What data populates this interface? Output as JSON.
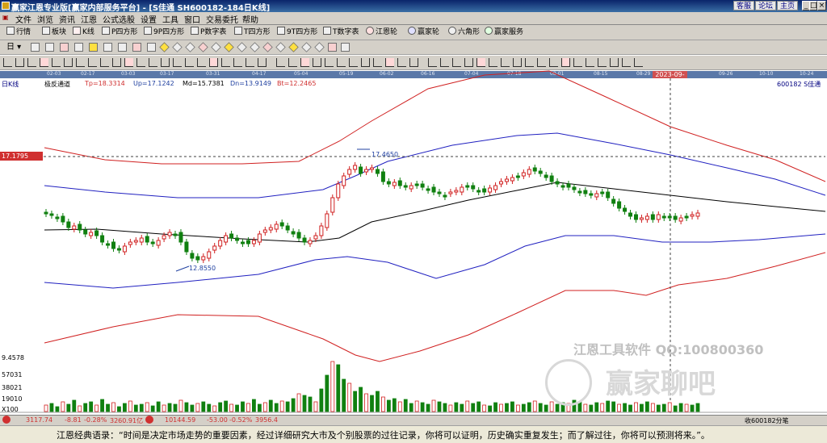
{
  "window": {
    "title": "赢家江恩专业版[赢家内部服务平台] - [S佳通  SH600182-184日K线]",
    "top_links": [
      "客服",
      "论坛",
      "主页"
    ],
    "window_buttons": [
      "_",
      "□",
      "×"
    ]
  },
  "menu": [
    "文件",
    "浏览",
    "资讯",
    "江恩",
    "公式选股",
    "设置",
    "工具",
    "窗口",
    "交易委托",
    "帮助"
  ],
  "toolbar1": [
    "行情",
    "板块",
    "K线",
    "P四方形",
    "9P四方形",
    "P数字表",
    "T四方形",
    "9T四方形",
    "T数字表",
    "江恩轮",
    "赢家轮",
    "六角形",
    "赢家服务"
  ],
  "toolbar2_label": "日",
  "dates": [
    "02-03",
    "02-17",
    "03-03",
    "03-17",
    "03-31",
    "04-17",
    "05-04",
    "05-19",
    "06-02",
    "06-16",
    "07-04",
    "07-18",
    "08-01",
    "08-15",
    "08-29",
    "09-26",
    "10-10",
    "10-24"
  ],
  "selected_date": "2023-09-07",
  "indicator": {
    "name": "极反通道",
    "tp": "Tp=18.3314",
    "up": "Up=17.1242",
    "md": "Md=15.7381",
    "dn": "Dn=13.9149",
    "bt": "Bt=12.2465"
  },
  "period_label": "日K线",
  "stock_label": "600182  S佳通",
  "cursor_price": "17.1795",
  "peak_label": "17.4650",
  "trough_label": "12.8550",
  "bottom_price": "9.4578",
  "volume_labels": [
    "57031",
    "38021",
    "19010"
  ],
  "volume_unit": "X100",
  "watermark": {
    "line1": "江恩工具软件  QQ:100800360",
    "line2": "赢家聊吧"
  },
  "statusbar": {
    "sh": "3117.74",
    "sh_chg": "-8.81",
    "sh_pct": "-0.28%",
    "sh_vol": "3260.91亿",
    "sz": "10144.59",
    "sz_chg": "-53.00",
    "sz_pct": "-0.52%",
    "sz_vol": "3956.4",
    "right": "收600182分笔"
  },
  "quote": "江恩经典语录：“时间是决定市场走势的重要因素，经过详细研究大市及个别股票的过往记录，你将可以证明，历史确实重复发生；而了解过往，你将可以预测将来。”。",
  "colors": {
    "outer_band": "#d02020",
    "inner_band": "#2020c0",
    "mid_line": "#000000",
    "up_candle": "#d02020",
    "down_candle": "#108010"
  }
}
